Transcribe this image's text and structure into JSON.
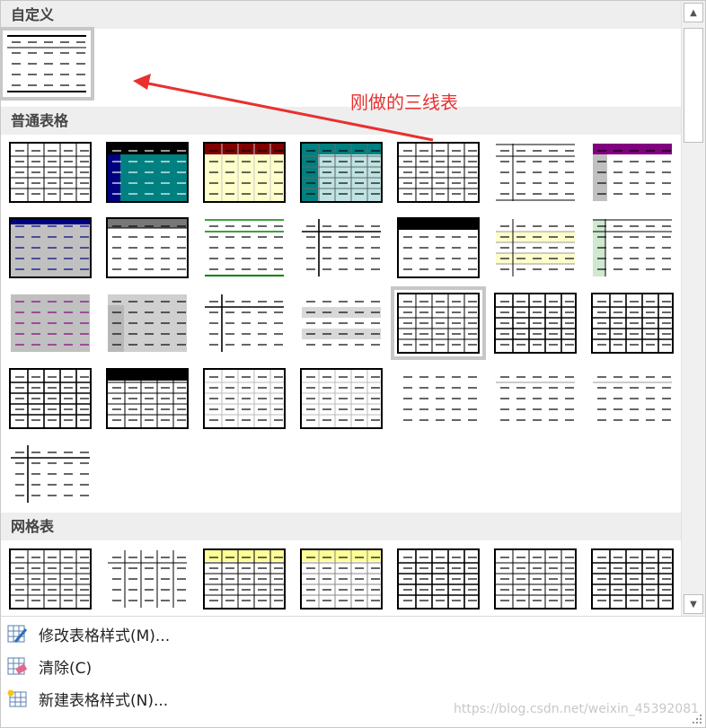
{
  "gallery": {
    "sections": [
      {
        "label": "自定义"
      },
      {
        "label": "普通表格"
      },
      {
        "label": "网格表"
      }
    ]
  },
  "annotation": {
    "text": "刚做的三线表"
  },
  "menu": {
    "items": [
      {
        "label": "修改表格样式(M)...",
        "icon": "table-edit-icon"
      },
      {
        "label": "清除(C)",
        "icon": "table-eraser-icon"
      },
      {
        "label": "新建表格样式(N)...",
        "icon": "table-new-icon"
      }
    ]
  },
  "watermark": {
    "text": "https://blog.csdn.net/weixin_45392081"
  },
  "colors": {
    "annotation": "#e8302f",
    "teal": "#008080",
    "dark_red": "#800000",
    "navy": "#000080",
    "purple": "#800080",
    "green": "#008000",
    "light_yellow": "#ffffcc",
    "gray": "#c0c0c0",
    "yellow_header": "#ffff99"
  }
}
